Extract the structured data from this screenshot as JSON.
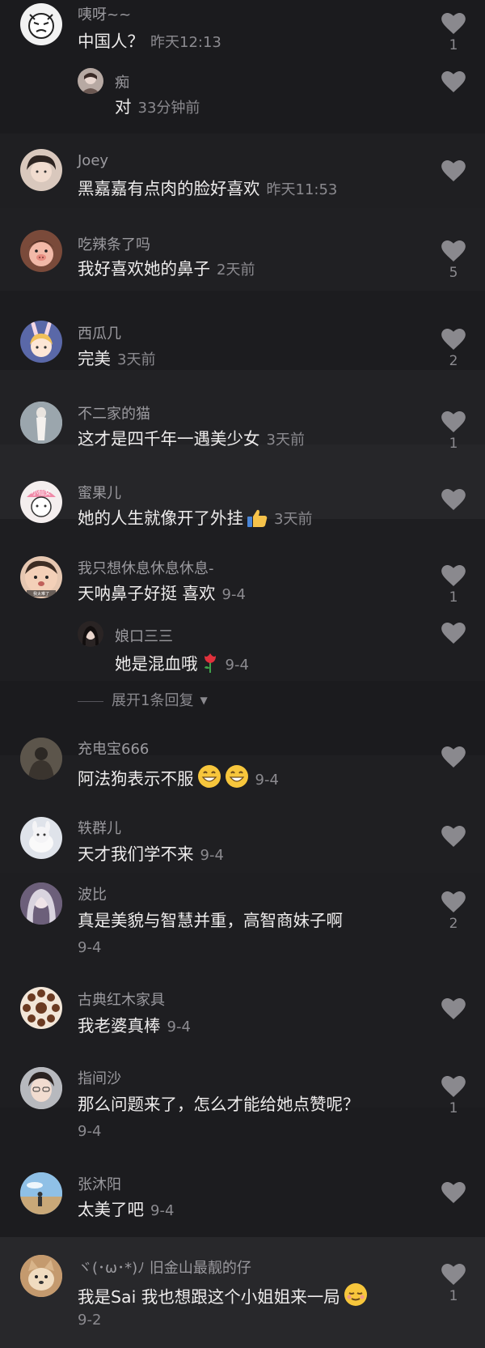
{
  "comments": [
    {
      "name": "咦呀~~",
      "text": "中国人？",
      "time": "昨天12:13",
      "likes": "1"
    },
    {
      "name": "痴",
      "text": "对",
      "time": "33分钟前",
      "likes": ""
    },
    {
      "name": "Joey",
      "text": "黑嘉嘉有点肉的脸好喜欢",
      "time": "昨天11:53",
      "likes": ""
    },
    {
      "name": "吃辣条了吗",
      "text": "我好喜欢她的鼻子",
      "time": "2天前",
      "likes": "5"
    },
    {
      "name": "西瓜几",
      "text": "完美",
      "time": "3天前",
      "likes": "2"
    },
    {
      "name": "不二家的猫",
      "text": "这才是四千年一遇美少女",
      "time": "3天前",
      "likes": "1"
    },
    {
      "name": "蜜果儿",
      "text": "她的人生就像开了外挂",
      "time": "3天前",
      "likes": ""
    },
    {
      "name": "我只想休息休息休息-",
      "text": "天呐鼻子好挺 喜欢",
      "time": "9-4",
      "likes": "1"
    },
    {
      "name": "娘口三三",
      "text": "她是混血哦",
      "time": "9-4",
      "likes": ""
    },
    {
      "name": "充电宝666",
      "text": "阿法狗表示不服",
      "time": "9-4",
      "likes": ""
    },
    {
      "name": "轶群儿",
      "text": "天才我们学不来",
      "time": "9-4",
      "likes": ""
    },
    {
      "name": "波比",
      "text": "真是美貌与智慧并重，高智商妹子啊",
      "time": "9-4",
      "likes": "2"
    },
    {
      "name": "古典红木家具",
      "text": "我老婆真棒",
      "time": "9-4",
      "likes": ""
    },
    {
      "name": "指间沙",
      "text": "那么问题来了，怎么才能给她点赞呢？",
      "time": "9-4",
      "likes": "1"
    },
    {
      "name": "张沐阳",
      "text": "太美了吧",
      "time": "9-4",
      "likes": ""
    },
    {
      "name": "ヾ(･ω･*)ﾉ 旧金山最靓的仔",
      "text": "我是Sai 我也想跟这个小姐姐来一局",
      "time": "9-2",
      "likes": "1"
    }
  ],
  "expand_replies": "展开1条回复",
  "avatar_texts": {
    "mifruit": "小仙女",
    "baby": "我太难了"
  },
  "icons": {
    "like": "heart-icon",
    "expand": "triangle-down-icon"
  },
  "colors": {
    "background": "#1d1d20",
    "name": "#9b9a9f",
    "text": "#eeecec",
    "meta": "#8b8a8f",
    "heart": "#8a898e"
  }
}
